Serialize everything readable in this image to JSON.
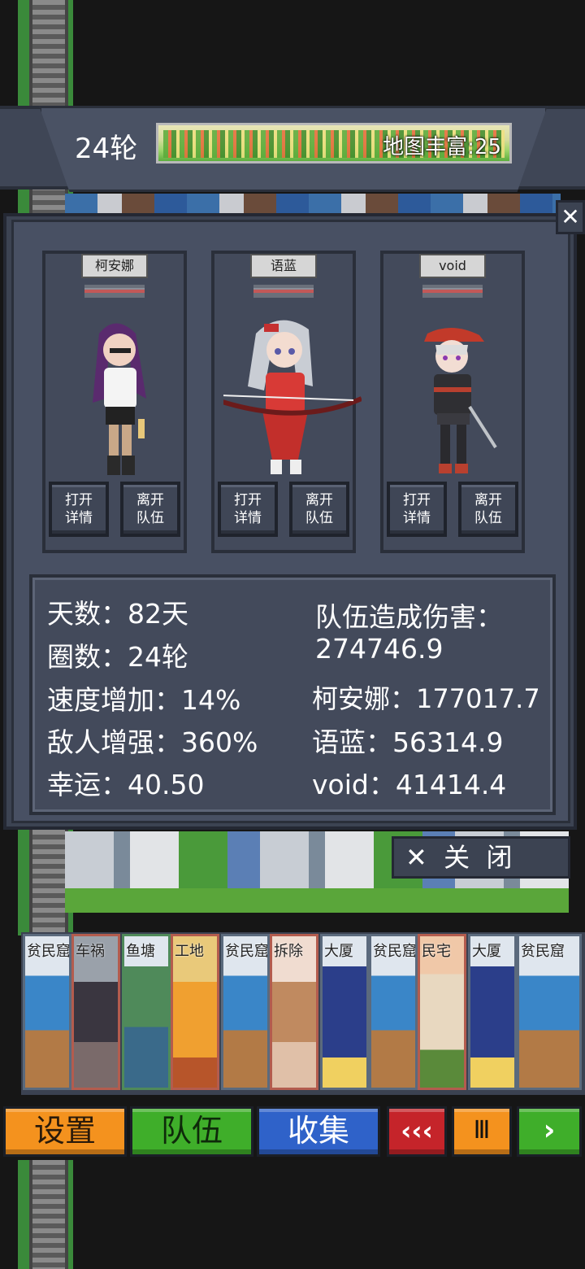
{
  "header": {
    "round": "24轮",
    "map_label": "地图丰富:25"
  },
  "dialog": {
    "close_x": "✕",
    "members": [
      {
        "name": "柯安娜",
        "detail": "打开\n详情",
        "leave": "离开\n队伍"
      },
      {
        "name": "语蓝",
        "detail": "打开\n详情",
        "leave": "离开\n队伍"
      },
      {
        "name": "void",
        "detail": "打开\n详情",
        "leave": "离开\n队伍"
      }
    ],
    "stats": {
      "days": "天数：82天",
      "laps": "圈数：24轮",
      "speed": "速度增加：14%",
      "enemy": "敌人增强：360%",
      "luck": "幸运：40.50",
      "damage_title": "队伍造成伤害：",
      "damage_total": "274746.9",
      "dmg1": "柯安娜：177017.7",
      "dmg2": "语蓝：56314.9",
      "dmg3": "void：41414.4"
    },
    "close_button": "✕  关  闭"
  },
  "cards": [
    "贫民窟",
    "车祸",
    "鱼塘",
    "工地",
    "贫民窟",
    "拆除",
    "大厦",
    "贫民窟",
    "民宅",
    "大厦",
    "贫民窟"
  ],
  "bottom": {
    "settings": "设置",
    "team": "队伍",
    "collect": "收集",
    "rewind": "‹‹‹",
    "pause": "Ⅲ",
    "next": "›"
  },
  "colors": {
    "settings": "#f4921e",
    "team": "#3fae2a",
    "collect": "#2f62c9",
    "rewind": "#c5242a",
    "pause": "#f4921e",
    "next": "#3fae2a"
  }
}
